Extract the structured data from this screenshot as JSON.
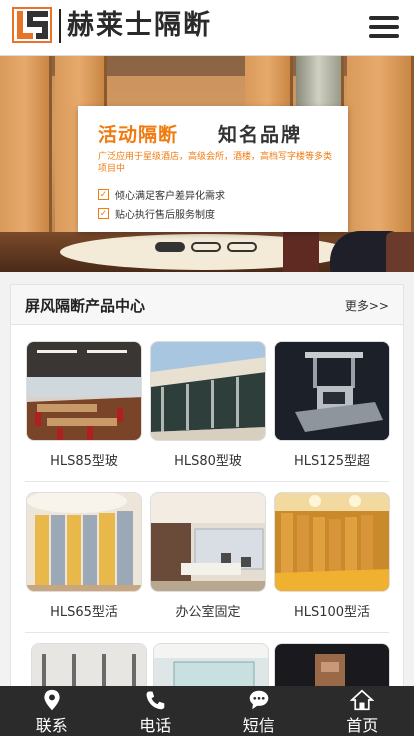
{
  "header": {
    "logo_text": "赫莱士隔断",
    "logo_icon": "hls-logo-icon",
    "menu_icon": "hamburger-menu-icon"
  },
  "banner": {
    "title_left": "活动隔断",
    "title_right": "知名品牌",
    "description": "广泛应用于星级酒店，高级会所，酒楼，高档写字楼等多类项目中",
    "features": [
      "倾心满足客户差异化需求",
      "贴心执行售后服务制度"
    ],
    "slides": 3,
    "active_slide": 1
  },
  "products": {
    "title": "屏风隔断产品中心",
    "more": "更多>>",
    "items": [
      {
        "name": "HLS85型玻"
      },
      {
        "name": "HLS80型玻"
      },
      {
        "name": "HLS125型超"
      },
      {
        "name": "HLS65型活"
      },
      {
        "name": "办公室固定"
      },
      {
        "name": "HLS100型活"
      }
    ]
  },
  "bottom_nav": [
    {
      "label": "联系",
      "icon": "location-pin-icon"
    },
    {
      "label": "电话",
      "icon": "phone-icon"
    },
    {
      "label": "短信",
      "icon": "chat-bubble-icon"
    },
    {
      "label": "首页",
      "icon": "home-icon"
    }
  ],
  "colors": {
    "accent": "#f07b10",
    "nav_bg": "#2b2b2b",
    "logo_orange": "#e8742a"
  }
}
